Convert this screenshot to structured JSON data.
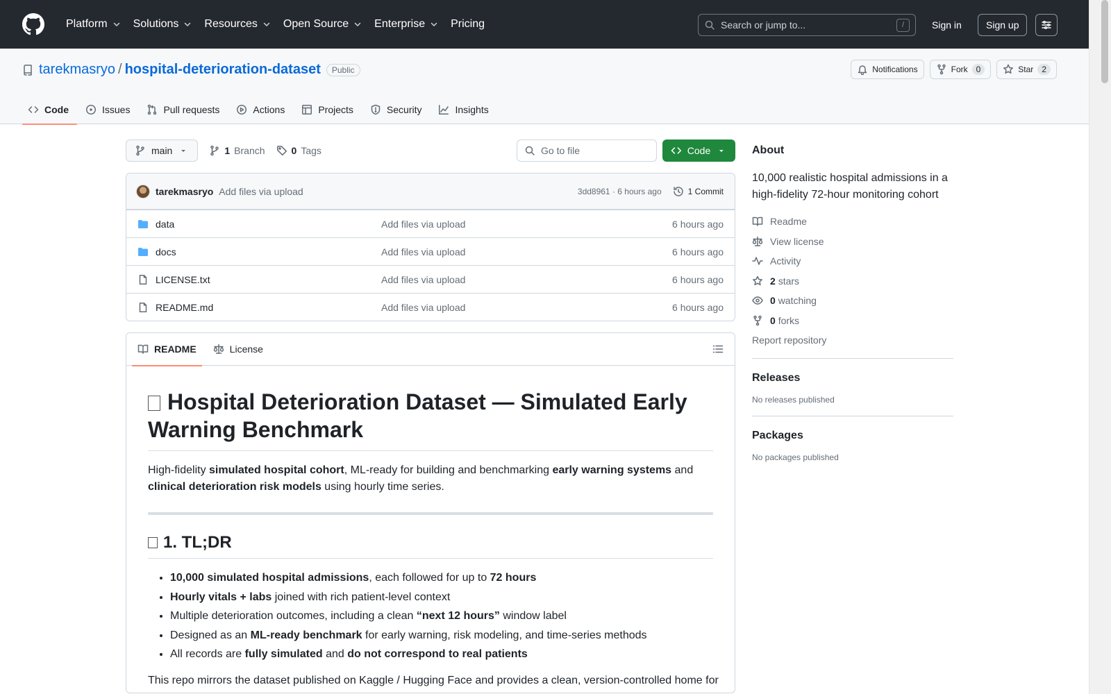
{
  "header": {
    "nav": [
      "Platform",
      "Solutions",
      "Resources",
      "Open Source",
      "Enterprise",
      "Pricing"
    ],
    "search_placeholder": "Search or jump to...",
    "search_shortcut": "/",
    "signin": "Sign in",
    "signup": "Sign up"
  },
  "repo": {
    "owner": "tarekmasryo",
    "separator": "/",
    "name": "hospital-deterioration-dataset",
    "visibility": "Public",
    "notifications": "Notifications",
    "fork_label": "Fork",
    "fork_count": "0",
    "star_label": "Star",
    "star_count": "2",
    "tabs": [
      "Code",
      "Issues",
      "Pull requests",
      "Actions",
      "Projects",
      "Security",
      "Insights"
    ]
  },
  "toolbar": {
    "branch": "main",
    "branch_count": "1",
    "branch_label": "Branch",
    "tag_count": "0",
    "tag_label": "Tags",
    "goto_placeholder": "Go to file",
    "code_button": "Code"
  },
  "commit": {
    "author": "tarekmasryo",
    "message": "Add files via upload",
    "hash_time": "3dd8961 · 6 hours ago",
    "count": "1 Commit"
  },
  "files": [
    {
      "name": "data",
      "type": "folder",
      "message": "Add files via upload",
      "time": "6 hours ago"
    },
    {
      "name": "docs",
      "type": "folder",
      "message": "Add files via upload",
      "time": "6 hours ago"
    },
    {
      "name": "LICENSE.txt",
      "type": "file",
      "message": "Add files via upload",
      "time": "6 hours ago"
    },
    {
      "name": "README.md",
      "type": "file",
      "message": "Add files via upload",
      "time": "6 hours ago"
    }
  ],
  "readme": {
    "tabs": [
      "README",
      "License"
    ],
    "title": "Hospital Deterioration Dataset — Simulated Early Warning Benchmark",
    "intro": [
      {
        "t": "High-fidelity ",
        "b": false
      },
      {
        "t": "simulated hospital cohort",
        "b": true
      },
      {
        "t": ", ML-ready for building and benchmarking ",
        "b": false
      },
      {
        "t": "early warning systems",
        "b": true
      },
      {
        "t": " and ",
        "b": false
      },
      {
        "t": "clinical deterioration risk models",
        "b": true
      },
      {
        "t": " using hourly time series.",
        "b": false
      }
    ],
    "section1": "1. TL;DR",
    "bullets": [
      [
        {
          "t": "10,000 simulated hospital admissions",
          "b": true
        },
        {
          "t": ", each followed for up to ",
          "b": false
        },
        {
          "t": "72 hours",
          "b": true
        }
      ],
      [
        {
          "t": "Hourly vitals + labs",
          "b": true
        },
        {
          "t": " joined with rich patient-level context",
          "b": false
        }
      ],
      [
        {
          "t": "Multiple deterioration outcomes, including a clean ",
          "b": false
        },
        {
          "t": "“next 12 hours”",
          "b": true
        },
        {
          "t": " window label",
          "b": false
        }
      ],
      [
        {
          "t": "Designed as an ",
          "b": false
        },
        {
          "t": "ML-ready benchmark",
          "b": true
        },
        {
          "t": " for early warning, risk modeling, and time-series methods",
          "b": false
        }
      ],
      [
        {
          "t": "All records are ",
          "b": false
        },
        {
          "t": "fully simulated",
          "b": true
        },
        {
          "t": " and ",
          "b": false
        },
        {
          "t": "do not correspond to real patients",
          "b": true
        }
      ]
    ],
    "trailing": "This repo mirrors the dataset published on Kaggle / Hugging Face and provides a clean, version-controlled home for"
  },
  "about": {
    "title": "About",
    "description": "10,000 realistic hospital admissions in a high-fidelity 72-hour monitoring cohort",
    "readme": "Readme",
    "license": "View license",
    "activity": "Activity",
    "stars_count": "2",
    "stars_label": "stars",
    "watching_count": "0",
    "watching_label": "watching",
    "forks_count": "0",
    "forks_label": "forks",
    "report": "Report repository"
  },
  "releases": {
    "title": "Releases",
    "empty": "No releases published"
  },
  "packages": {
    "title": "Packages",
    "empty": "No packages published"
  }
}
